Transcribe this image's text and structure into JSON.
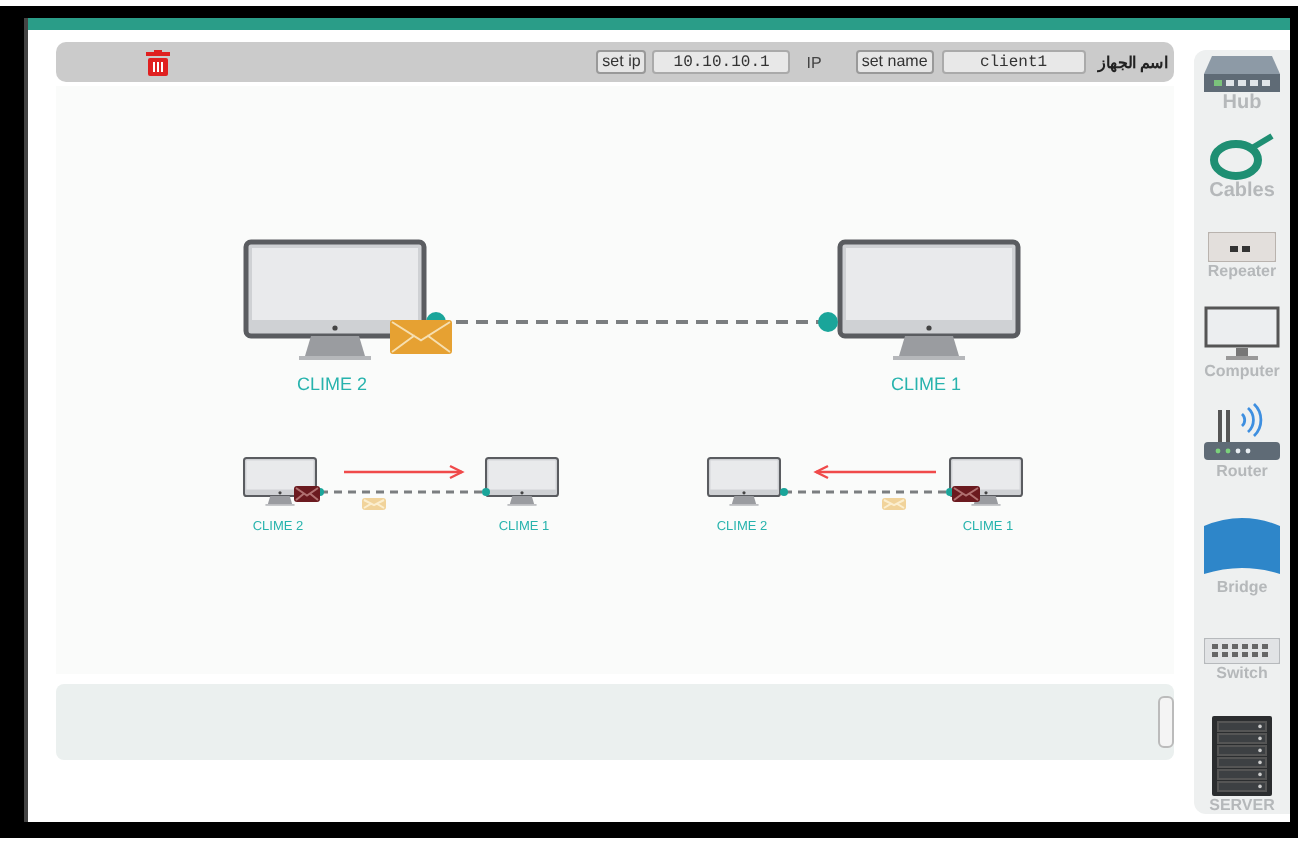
{
  "toolbar": {
    "set_ip_button": "set ip",
    "ip_value": "10.10.10.1",
    "ip_label": "IP",
    "set_name_button": "set name",
    "name_value": "client1",
    "name_label": "اسم الجهاز"
  },
  "diagram": {
    "networks": [
      {
        "kind": "large",
        "nodes": [
          {
            "label": "CLIME 2",
            "sending": true
          },
          {
            "label": "CLIME 1",
            "sending": false
          }
        ]
      },
      {
        "kind": "small",
        "nodes": [
          {
            "label": "CLIME 2",
            "sending": true
          },
          {
            "label": "CLIME 1",
            "sending": false
          }
        ]
      },
      {
        "kind": "small",
        "nodes": [
          {
            "label": "CLIME 2",
            "sending": false
          },
          {
            "label": "CLIME 1",
            "sending": true
          }
        ]
      }
    ]
  },
  "sidebar": {
    "items": [
      {
        "kind": "hub",
        "label": "Hub"
      },
      {
        "kind": "cables",
        "label": "Cables"
      },
      {
        "kind": "repeater",
        "label": "Repeater"
      },
      {
        "kind": "computer",
        "label": "Computer"
      },
      {
        "kind": "router",
        "label": "Router"
      },
      {
        "kind": "bridge",
        "label": "Bridge"
      },
      {
        "kind": "switch",
        "label": "Switch"
      },
      {
        "kind": "server",
        "label": "SERVER"
      }
    ]
  }
}
